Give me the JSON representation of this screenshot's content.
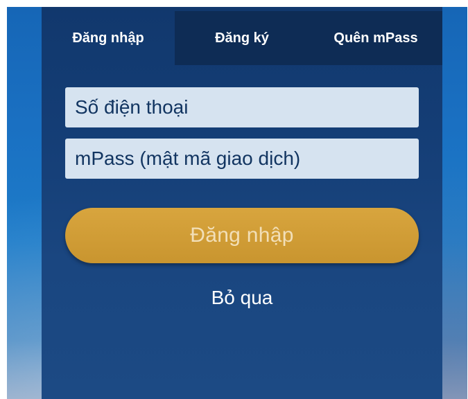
{
  "tabs": [
    {
      "label": "Đăng nhập",
      "active": true
    },
    {
      "label": "Đăng ký",
      "active": false
    },
    {
      "label": "Quên mPass",
      "active": false
    }
  ],
  "form": {
    "phone_placeholder": "Số điện thoại",
    "mpass_placeholder": "mPass (mật mã giao dịch)",
    "login_label": "Đăng nhập",
    "skip_label": "Bỏ qua"
  },
  "colors": {
    "background_blue": "#1a70c2",
    "panel_navy": "#143d75",
    "inactive_tab": "#0e2c55",
    "field_bg": "#d6e3f0",
    "button_gold": "#d2a03a"
  }
}
